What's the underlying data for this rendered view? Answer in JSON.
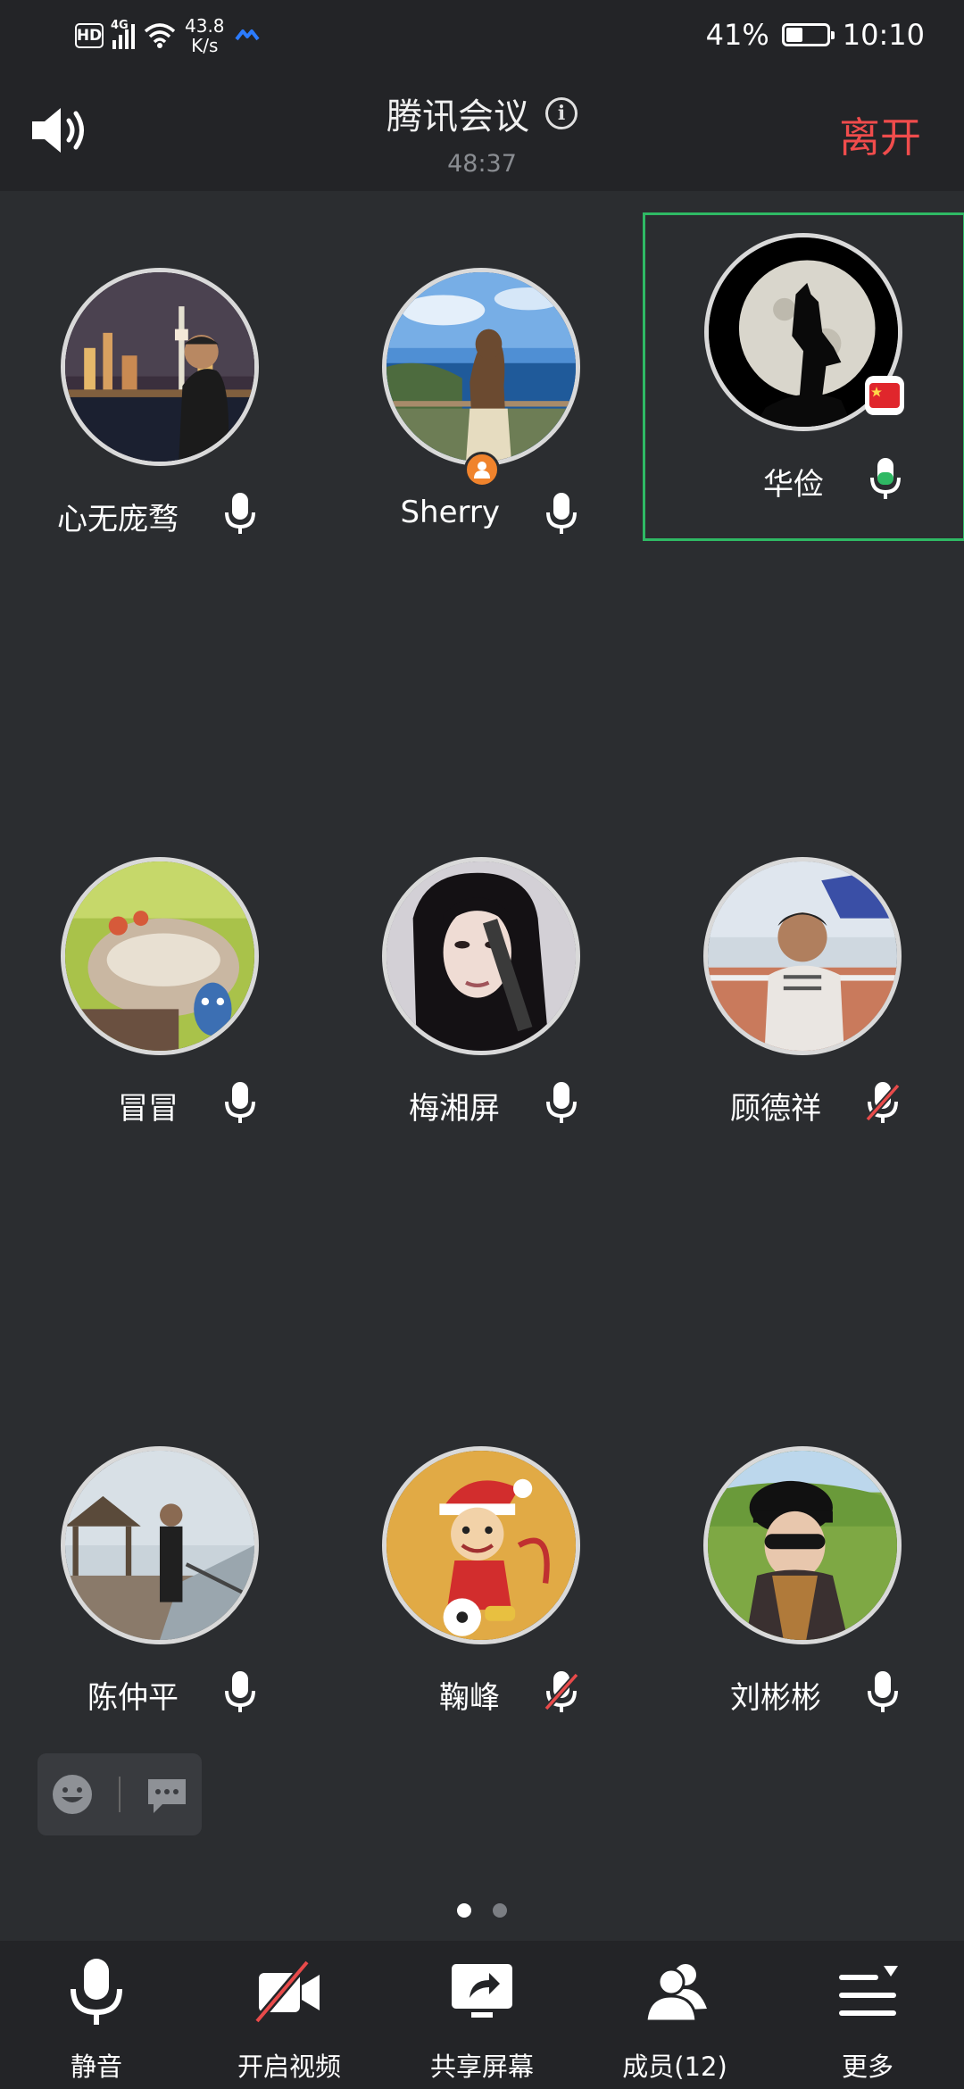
{
  "status_bar": {
    "hd": "HD",
    "network": "4G",
    "speed_value": "43.8",
    "speed_unit": "K/s",
    "battery_percent_label": "41%",
    "battery_level": 0.41,
    "time": "10:10"
  },
  "header": {
    "speaker_icon": "speaker-icon",
    "title": "腾讯会议",
    "info_icon": "info-icon",
    "elapsed": "48:37",
    "leave_label": "离开"
  },
  "participants": [
    {
      "name": "心无庞骛",
      "mic": "on",
      "photo": "city-night-skyline"
    },
    {
      "name": "Sherry",
      "mic": "on",
      "photo": "girl-by-sea",
      "host": true
    },
    {
      "name": "华俭",
      "mic": "speaking",
      "photo": "wolf-moon",
      "active": true
    },
    {
      "name": "冒冒",
      "mic": "on",
      "photo": "cartoon-totoro"
    },
    {
      "name": "梅湘屏",
      "mic": "on",
      "photo": "dark-hair-girl"
    },
    {
      "name": "顾德祥",
      "mic": "muted",
      "photo": "man-tennis-court"
    },
    {
      "name": "陈仲平",
      "mic": "on",
      "photo": "man-on-boardwalk"
    },
    {
      "name": "鞠峰",
      "mic": "muted",
      "photo": "cartoon-monkey-soccer"
    },
    {
      "name": "刘彬彬",
      "mic": "on",
      "photo": "woman-with-hat"
    }
  ],
  "pager": {
    "pages": 2,
    "current": 1
  },
  "toolbar": {
    "mute_label": "静音",
    "video_label": "开启视频",
    "share_label": "共享屏幕",
    "members_label": "成员(12)",
    "more_label": "更多"
  },
  "colors": {
    "background": "#2b2d30",
    "bar": "#232427",
    "leave": "#f04c4c",
    "active_border": "#2fb964",
    "speaking_mic": "#2fb964",
    "muted_slash": "#e84a4a",
    "host_badge": "#f0832c"
  }
}
